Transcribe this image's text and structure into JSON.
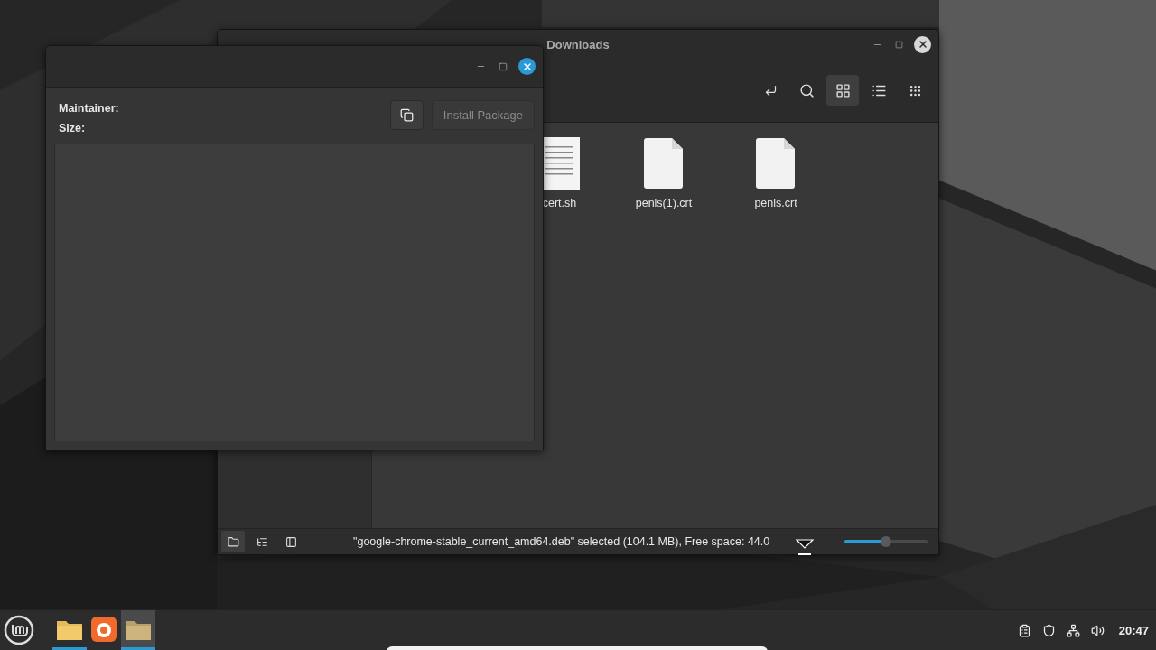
{
  "file_manager": {
    "title": "Downloads",
    "views": [
      {
        "kind": "grid",
        "selected": true
      },
      {
        "kind": "list",
        "selected": false
      },
      {
        "kind": "compact",
        "selected": false
      }
    ],
    "files": [
      {
        "name": "cert.sh",
        "kind": "script"
      },
      {
        "name": "penis(1).crt",
        "kind": "blank"
      },
      {
        "name": "penis.crt",
        "kind": "blank"
      }
    ],
    "status_text": "\"google-chrome-stable_current_amd64.deb\" selected (104.1 MB), Free space: 44.0",
    "zoom": {
      "level": 0.5
    }
  },
  "installer": {
    "fields": [
      {
        "label": "Maintainer:"
      },
      {
        "label": "Size:"
      }
    ],
    "install_button": {
      "label": "Install Package",
      "disabled": true
    }
  },
  "taskbar": {
    "apps": [
      {
        "kind": "folder",
        "running": true,
        "focused": false
      },
      {
        "kind": "browser",
        "running": false,
        "focused": false
      },
      {
        "kind": "files",
        "running": true,
        "focused": true
      }
    ],
    "clock": "20:47"
  }
}
